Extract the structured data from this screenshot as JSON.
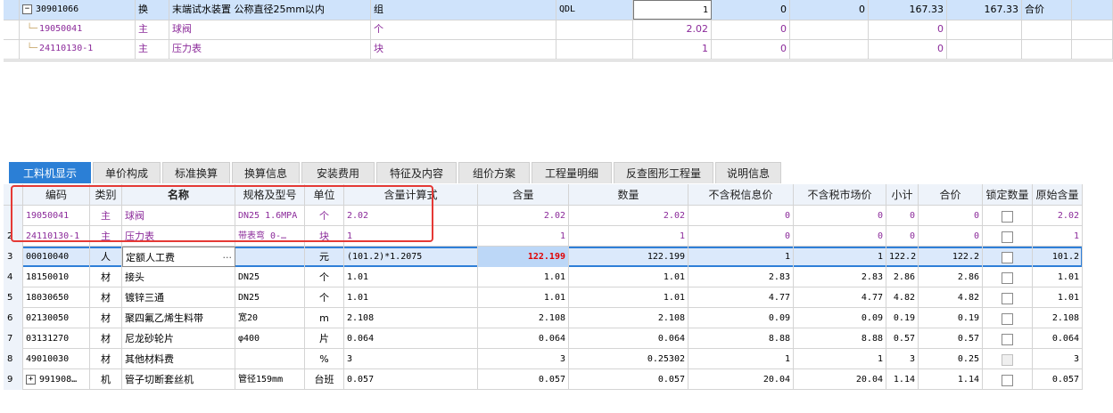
{
  "top_grid": {
    "rows": [
      {
        "code": "30901066",
        "type": "换",
        "name": "末端试水装置 公称直径25mm以内",
        "unit": "组",
        "expr": "QDL",
        "qty": "1",
        "c7": "0",
        "c8": "0",
        "c9": "167.33",
        "c10": "167.33",
        "c11": "合价",
        "tree": "−",
        "purple": false
      },
      {
        "code": "19050041",
        "type": "主",
        "name": "球阀",
        "unit": "个",
        "expr": "",
        "qty": "2.02",
        "c7": "0",
        "c8": "",
        "c9": "0",
        "c10": "",
        "c11": "",
        "tree": "",
        "purple": true
      },
      {
        "code": "24110130-1",
        "type": "主",
        "name": "压力表",
        "unit": "块",
        "expr": "",
        "qty": "1",
        "c7": "0",
        "c8": "",
        "c9": "0",
        "c10": "",
        "c11": "",
        "tree": "",
        "purple": true
      }
    ]
  },
  "tabs": [
    "工料机显示",
    "单价构成",
    "标准换算",
    "换算信息",
    "安装费用",
    "特征及内容",
    "组价方案",
    "工程量明细",
    "反查图形工程量",
    "说明信息"
  ],
  "columns": [
    "编码",
    "类别",
    "名称",
    "规格及型号",
    "单位",
    "含量计算式",
    "含量",
    "数量",
    "不含税信息价",
    "不含税市场价",
    "小计",
    "合价",
    "锁定数量",
    "原始含量"
  ],
  "rows": [
    {
      "num": "",
      "code": "19050041",
      "cat": "主",
      "name": "球阀",
      "spec": "DN25 1.6MPA",
      "unit": "个",
      "expr": "2.02",
      "content": "2.02",
      "qty": "2.02",
      "info_price": "0",
      "market_price": "0",
      "subtotal": "0",
      "total": "0",
      "lock": "unchecked",
      "orig": "2.02",
      "purple": true
    },
    {
      "num": "2",
      "code": "24110130-1",
      "cat": "主",
      "name": "压力表",
      "spec": "带表弯 0-…",
      "unit": "块",
      "expr": "1",
      "content": "1",
      "qty": "1",
      "info_price": "0",
      "market_price": "0",
      "subtotal": "0",
      "total": "0",
      "lock": "unchecked",
      "orig": "1",
      "purple": true
    },
    {
      "num": "3",
      "code": "00010040",
      "cat": "人",
      "name": "定额人工费",
      "spec": "",
      "unit": "元",
      "expr": "(101.2)*1.2075",
      "content": "122.199",
      "qty": "122.199",
      "info_price": "1",
      "market_price": "1",
      "subtotal": "122.2",
      "total": "122.2",
      "lock": "unchecked",
      "orig": "101.2",
      "purple": false,
      "current": true
    },
    {
      "num": "4",
      "code": "18150010",
      "cat": "材",
      "name": "接头",
      "spec": "DN25",
      "unit": "个",
      "expr": "1.01",
      "content": "1.01",
      "qty": "1.01",
      "info_price": "2.83",
      "market_price": "2.83",
      "subtotal": "2.86",
      "total": "2.86",
      "lock": "unchecked",
      "orig": "1.01",
      "purple": false
    },
    {
      "num": "5",
      "code": "18030650",
      "cat": "材",
      "name": "镀锌三通",
      "spec": "DN25",
      "unit": "个",
      "expr": "1.01",
      "content": "1.01",
      "qty": "1.01",
      "info_price": "4.77",
      "market_price": "4.77",
      "subtotal": "4.82",
      "total": "4.82",
      "lock": "unchecked",
      "orig": "1.01",
      "purple": false
    },
    {
      "num": "6",
      "code": "02130050",
      "cat": "材",
      "name": "聚四氟乙烯生料带",
      "spec": "宽20",
      "unit": "m",
      "expr": "2.108",
      "content": "2.108",
      "qty": "2.108",
      "info_price": "0.09",
      "market_price": "0.09",
      "subtotal": "0.19",
      "total": "0.19",
      "lock": "unchecked",
      "orig": "2.108",
      "purple": false
    },
    {
      "num": "7",
      "code": "03131270",
      "cat": "材",
      "name": "尼龙砂轮片",
      "spec": "φ400",
      "unit": "片",
      "expr": "0.064",
      "content": "0.064",
      "qty": "0.064",
      "info_price": "8.88",
      "market_price": "8.88",
      "subtotal": "0.57",
      "total": "0.57",
      "lock": "unchecked",
      "orig": "0.064",
      "purple": false
    },
    {
      "num": "8",
      "code": "49010030",
      "cat": "材",
      "name": "其他材料费",
      "spec": "",
      "unit": "%",
      "expr": "3",
      "content": "3",
      "qty": "0.25302",
      "info_price": "1",
      "market_price": "1",
      "subtotal": "3",
      "total": "0.25",
      "lock": "disabled",
      "orig": "3",
      "purple": false
    },
    {
      "num": "9",
      "code": "991908…",
      "cat": "机",
      "name": "管子切断套丝机",
      "spec": "管径159mm",
      "unit": "台班",
      "expr": "0.057",
      "content": "0.057",
      "qty": "0.057",
      "info_price": "20.04",
      "market_price": "20.04",
      "subtotal": "1.14",
      "total": "1.14",
      "lock": "unchecked",
      "orig": "0.057",
      "purple": false,
      "tree": "+"
    }
  ],
  "colors": {
    "accent": "#2b7fd6",
    "highlight_red": "#e53935",
    "purple_text": "#8b2a9a"
  }
}
